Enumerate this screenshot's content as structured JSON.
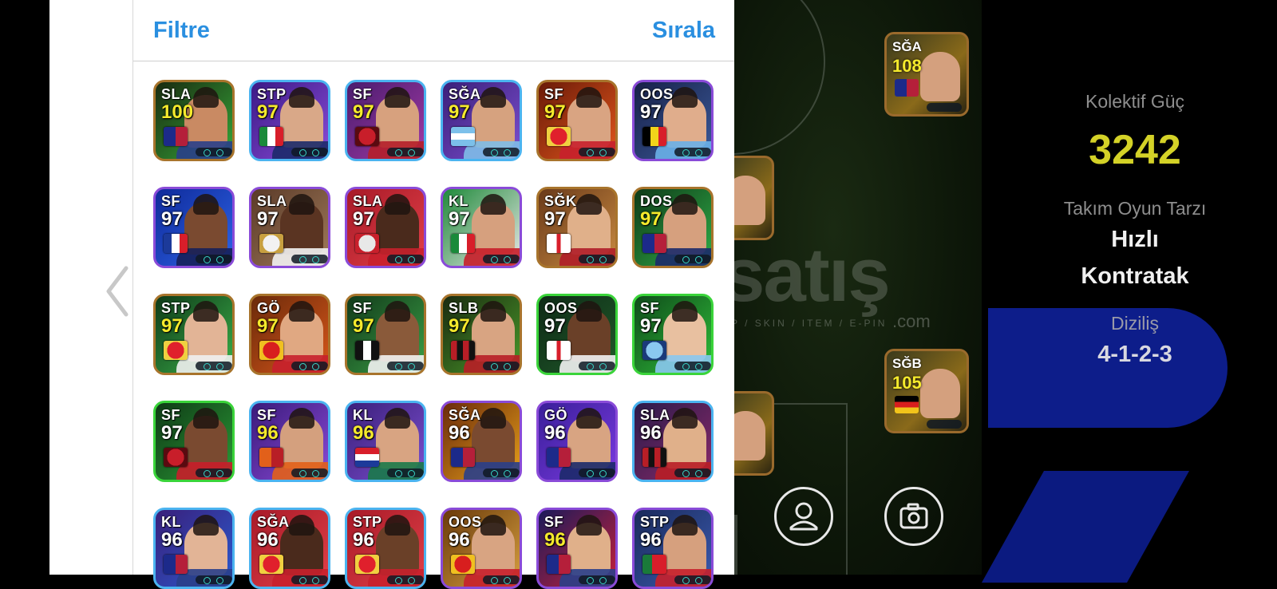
{
  "header": {
    "filter_label": "Filtre",
    "sort_label": "Sırala"
  },
  "cards": [
    {
      "pos": "SLA",
      "ovr": "100",
      "ovr_color": "yellow",
      "bg": [
        "#1a2a10",
        "#35a83a"
      ],
      "border": "#a8742c",
      "emb": "barca",
      "face": "#c98a63",
      "shirt": "#2a3f8a"
    },
    {
      "pos": "STP",
      "ovr": "97",
      "ovr_color": "yellow",
      "bg": [
        "#3b1a86",
        "#8a4bd8"
      ],
      "border": "#4bb4f0",
      "emb": "italy",
      "face": "#d9a888",
      "shirt": "#1c2a6a"
    },
    {
      "pos": "SF",
      "ovr": "97",
      "ovr_color": "yellow",
      "bg": [
        "#4a1c6e",
        "#a23aa5"
      ],
      "border": "#4bb4f0",
      "emb": "liverpool",
      "face": "#d7a17e",
      "shirt": "#b51f2a"
    },
    {
      "pos": "SĞA",
      "ovr": "97",
      "ovr_color": "yellow",
      "bg": [
        "#3a1f7a",
        "#7c4fd0"
      ],
      "border": "#4bb4f0",
      "emb": "argentina",
      "face": "#d6a27f",
      "shirt": "#7fbce8"
    },
    {
      "pos": "SF",
      "ovr": "97",
      "ovr_color": "yellow",
      "bg": [
        "#6a1a08",
        "#e2561c"
      ],
      "border": "#a8742c",
      "emb": "arsenal",
      "face": "#d9a482",
      "shirt": "#c8202c"
    },
    {
      "pos": "OOS",
      "ovr": "97",
      "ovr_color": "white",
      "bg": [
        "#172048",
        "#3b5a9a"
      ],
      "border": "#8a4bd8",
      "emb": "belgium",
      "face": "#e0ad8c",
      "shirt": "#6ab0e8"
    },
    {
      "pos": "SF",
      "ovr": "97",
      "ovr_color": "white",
      "bg": [
        "#0f2a9a",
        "#2d63e6"
      ],
      "border": "#8a4bd8",
      "emb": "france",
      "face": "#7a4a30",
      "shirt": "#16205a"
    },
    {
      "pos": "SLA",
      "ovr": "97",
      "ovr_color": "white",
      "bg": [
        "#5a3a28",
        "#a07a5a"
      ],
      "border": "#8a4bd8",
      "emb": "realmadrid",
      "face": "#5a3422",
      "shirt": "#f2f2f2"
    },
    {
      "pos": "SLA",
      "ovr": "97",
      "ovr_color": "white",
      "bg": [
        "#a81a28",
        "#e24048"
      ],
      "border": "#8a4bd8",
      "emb": "bayern",
      "face": "#4a2a1c",
      "shirt": "#c8202c"
    },
    {
      "pos": "KL",
      "ovr": "97",
      "ovr_color": "white",
      "bg": [
        "#1f8a3a",
        "#e8e8e8"
      ],
      "border": "#8a4bd8",
      "emb": "italy",
      "face": "#d6a07e",
      "shirt": "#c81e2a"
    },
    {
      "pos": "SĞK",
      "ovr": "97",
      "ovr_color": "white",
      "bg": [
        "#6a3a1a",
        "#c98a40"
      ],
      "border": "#a8742c",
      "emb": "england",
      "face": "#e0b08a",
      "shirt": "#b01e28"
    },
    {
      "pos": "DOS",
      "ovr": "97",
      "ovr_color": "yellow",
      "bg": [
        "#0f3a18",
        "#2fae48"
      ],
      "border": "#a8742c",
      "emb": "barca",
      "face": "#d6a07e",
      "shirt": "#1c2a6a"
    },
    {
      "pos": "STP",
      "ovr": "97",
      "ovr_color": "yellow",
      "bg": [
        "#0f3a18",
        "#3ab04a"
      ],
      "border": "#a8742c",
      "emb": "arsenal",
      "face": "#e2b496",
      "shirt": "#f0f0f0"
    },
    {
      "pos": "GÖ",
      "ovr": "97",
      "ovr_color": "yellow",
      "bg": [
        "#6a2a0a",
        "#d8561a"
      ],
      "border": "#a8742c",
      "emb": "manutd",
      "face": "#e0a882",
      "shirt": "#c8202c"
    },
    {
      "pos": "SF",
      "ovr": "97",
      "ovr_color": "yellow",
      "bg": [
        "#123a1a",
        "#3aa046"
      ],
      "border": "#a8742c",
      "emb": "santos",
      "face": "#8a5a3a",
      "shirt": "#f2f2f2"
    },
    {
      "pos": "SLB",
      "ovr": "97",
      "ovr_color": "yellow",
      "bg": [
        "#1a2a10",
        "#4a9a2a"
      ],
      "border": "#a8742c",
      "emb": "milan",
      "face": "#d8a482",
      "shirt": "#b81e26"
    },
    {
      "pos": "OOS",
      "ovr": "97",
      "ovr_color": "white",
      "bg": [
        "#0f2a16",
        "#1f5a2a"
      ],
      "border": "#3ad43a",
      "emb": "england",
      "face": "#6a4028",
      "shirt": "#f2f2f2"
    },
    {
      "pos": "SF",
      "ovr": "97",
      "ovr_color": "white",
      "bg": [
        "#0f4a1a",
        "#2fbe3a"
      ],
      "border": "#3ad43a",
      "emb": "mancity",
      "face": "#e8c0a0",
      "shirt": "#8ac8f0"
    },
    {
      "pos": "SF",
      "ovr": "97",
      "ovr_color": "white",
      "bg": [
        "#0f3a16",
        "#2a9a36"
      ],
      "border": "#3ad43a",
      "emb": "liverpool",
      "face": "#7a4a30",
      "shirt": "#c81e2a"
    },
    {
      "pos": "SF",
      "ovr": "96",
      "ovr_color": "yellow",
      "bg": [
        "#3a1a7a",
        "#8a4ad8"
      ],
      "border": "#4bb4f0",
      "emb": "galatasaray",
      "face": "#d4a07e",
      "shirt": "#e2601a"
    },
    {
      "pos": "KL",
      "ovr": "96",
      "ovr_color": "yellow",
      "bg": [
        "#3a1f7a",
        "#7c4fd0"
      ],
      "border": "#4bb4f0",
      "emb": "croatia",
      "face": "#d8a482",
      "shirt": "#1a7a4a"
    },
    {
      "pos": "SĞA",
      "ovr": "96",
      "ovr_color": "white",
      "bg": [
        "#6a2a0a",
        "#e8a01a"
      ],
      "border": "#8a4bd8",
      "emb": "barca",
      "face": "#7a4a30",
      "shirt": "#2a3f8a"
    },
    {
      "pos": "GÖ",
      "ovr": "96",
      "ovr_color": "white",
      "bg": [
        "#3a1f9a",
        "#7a3ae0"
      ],
      "border": "#8a4bd8",
      "emb": "barca",
      "face": "#d8a482",
      "shirt": "#1c2a6a"
    },
    {
      "pos": "SLA",
      "ovr": "96",
      "ovr_color": "white",
      "bg": [
        "#2a1a4a",
        "#8a2a6a"
      ],
      "border": "#4bb4f0",
      "emb": "milan",
      "face": "#e0b08a",
      "shirt": "#b81e26"
    },
    {
      "pos": "KL",
      "ovr": "96",
      "ovr_color": "white",
      "bg": [
        "#3a1f7a",
        "#2a5ad0"
      ],
      "border": "#4bb4f0",
      "emb": "barca",
      "face": "#e2b496",
      "shirt": "#2a3f8a"
    },
    {
      "pos": "SĞA",
      "ovr": "96",
      "ovr_color": "white",
      "bg": [
        "#a81a28",
        "#e24048"
      ],
      "border": "#4bb4f0",
      "emb": "arsenal",
      "face": "#4a2a1c",
      "shirt": "#c8202c"
    },
    {
      "pos": "STP",
      "ovr": "96",
      "ovr_color": "white",
      "bg": [
        "#a81a28",
        "#e24048"
      ],
      "border": "#4bb4f0",
      "emb": "arsenal",
      "face": "#6a4028",
      "shirt": "#c8202c"
    },
    {
      "pos": "OOS",
      "ovr": "96",
      "ovr_color": "white",
      "bg": [
        "#6a3a0a",
        "#d8a040"
      ],
      "border": "#8a4bd8",
      "emb": "manutd",
      "face": "#d8a482",
      "shirt": "#c8202c"
    },
    {
      "pos": "SF",
      "ovr": "96",
      "ovr_color": "yellow",
      "bg": [
        "#1a1a5a",
        "#c8203a"
      ],
      "border": "#8a4bd8",
      "emb": "barca",
      "face": "#e0b08a",
      "shirt": "#2a3f8a"
    },
    {
      "pos": "STP",
      "ovr": "96",
      "ovr_color": "white",
      "bg": [
        "#1a2a5a",
        "#3a5ab0"
      ],
      "border": "#8a4bd8",
      "emb": "portugal",
      "face": "#d6a07e",
      "shirt": "#c8202c"
    }
  ],
  "pitch_cards": [
    {
      "pos": "SĞA",
      "ovr": "108",
      "emb": "barca"
    },
    {
      "pos": "SĞB",
      "ovr": "105",
      "emb": "germany"
    }
  ],
  "watermark": {
    "text": "satış",
    "sub": "AP / SKIN / ITEM / E-PIN",
    "com": ".com"
  },
  "stats": {
    "collective_label": "Kolektif Güç",
    "collective_value": "3242",
    "style_label": "Takım Oyun Tarzı",
    "style_value_line1": "Hızlı",
    "style_value_line2": "Kontratak",
    "formation_label": "Diziliş",
    "formation_value": "4-1-2-3"
  },
  "colors": {
    "accent_blue": "#2a8fe0",
    "rating_yellow": "#f5ea2c",
    "collective_yellow": "#d4d227"
  },
  "icons": {
    "profile": "profile-icon",
    "camera": "camera-icon",
    "back": "chevron-left-icon"
  }
}
